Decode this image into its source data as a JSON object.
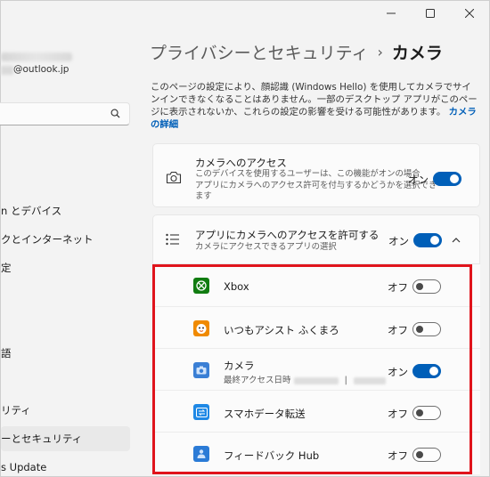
{
  "window": {
    "controls": [
      "minimize-icon",
      "maximize-icon",
      "close-icon"
    ]
  },
  "sidebar": {
    "user_email": "@outlook.jp",
    "nav": [
      {
        "label": "n とデバイス",
        "active": false
      },
      {
        "label": "クとインターネット",
        "active": false
      },
      {
        "label": "定",
        "active": false
      },
      {
        "label": "語",
        "active": false
      },
      {
        "label": "リティ",
        "active": false
      },
      {
        "label": "ーとセキュリティ",
        "active": true
      },
      {
        "label": "s Update",
        "active": false
      }
    ]
  },
  "main": {
    "breadcrumb_parent": "プライバシーとセキュリティ",
    "breadcrumb_sep": "›",
    "breadcrumb_current": "カメラ",
    "description": "このページの設定により、顔認識 (Windows Hello) を使用してカメラでサインインできなくなることはありません。一部のデスクトップ アプリがこのページに表示されないか、これらの設定の影響を受ける可能性があります。",
    "description_link": "カメラの詳細",
    "camera_access": {
      "title": "カメラへのアクセス",
      "subtitle_line1": "このデバイスを使用するユーザーは、この機能がオンの場合",
      "subtitle_line2": "アプリにカメラへのアクセス許可を付与するかどうかを選択でき",
      "subtitle_line3": "ます",
      "state": "オン"
    },
    "app_access": {
      "title": "アプリにカメラへのアクセスを許可する",
      "subtitle": "カメラにアクセスできるアプリの選択",
      "state": "オン"
    },
    "apps": [
      {
        "name": "Xbox",
        "state": "オフ",
        "on": false,
        "icon": "xbox-icon",
        "color": "#107c10"
      },
      {
        "name": "いつもアシスト ふくまろ",
        "state": "オフ",
        "on": false,
        "icon": "fukumaro-icon",
        "color": "#f5a623"
      },
      {
        "name": "カメラ",
        "sub": "最終アクセス日時",
        "sub_sep": "|",
        "state": "オン",
        "on": true,
        "icon": "camera-app-icon",
        "color": "#3a7fd5"
      },
      {
        "name": "スマホデータ転送",
        "state": "オフ",
        "on": false,
        "icon": "phone-transfer-icon",
        "color": "#1e88e5"
      },
      {
        "name": "フィードバック Hub",
        "state": "オフ",
        "on": false,
        "icon": "feedback-hub-icon",
        "color": "#2b7bd6"
      }
    ]
  },
  "colors": {
    "accent": "#005fb8",
    "highlight": "#e0141c"
  }
}
